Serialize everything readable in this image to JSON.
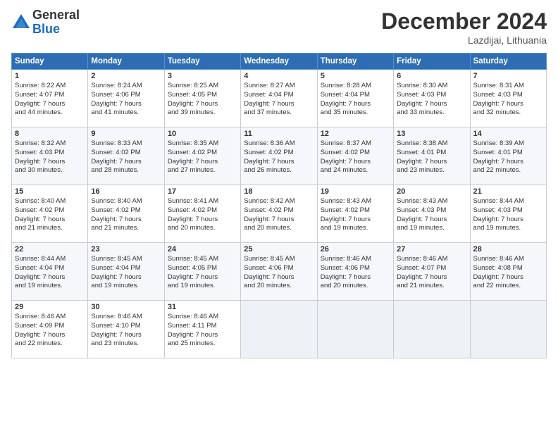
{
  "logo": {
    "general": "General",
    "blue": "Blue"
  },
  "header": {
    "month": "December 2024",
    "location": "Lazdijai, Lithuania"
  },
  "weekdays": [
    "Sunday",
    "Monday",
    "Tuesday",
    "Wednesday",
    "Thursday",
    "Friday",
    "Saturday"
  ],
  "weeks": [
    [
      {
        "day": "1",
        "lines": [
          "Sunrise: 8:22 AM",
          "Sunset: 4:07 PM",
          "Daylight: 7 hours",
          "and 44 minutes."
        ]
      },
      {
        "day": "2",
        "lines": [
          "Sunrise: 8:24 AM",
          "Sunset: 4:06 PM",
          "Daylight: 7 hours",
          "and 41 minutes."
        ]
      },
      {
        "day": "3",
        "lines": [
          "Sunrise: 8:25 AM",
          "Sunset: 4:05 PM",
          "Daylight: 7 hours",
          "and 39 minutes."
        ]
      },
      {
        "day": "4",
        "lines": [
          "Sunrise: 8:27 AM",
          "Sunset: 4:04 PM",
          "Daylight: 7 hours",
          "and 37 minutes."
        ]
      },
      {
        "day": "5",
        "lines": [
          "Sunrise: 8:28 AM",
          "Sunset: 4:04 PM",
          "Daylight: 7 hours",
          "and 35 minutes."
        ]
      },
      {
        "day": "6",
        "lines": [
          "Sunrise: 8:30 AM",
          "Sunset: 4:03 PM",
          "Daylight: 7 hours",
          "and 33 minutes."
        ]
      },
      {
        "day": "7",
        "lines": [
          "Sunrise: 8:31 AM",
          "Sunset: 4:03 PM",
          "Daylight: 7 hours",
          "and 32 minutes."
        ]
      }
    ],
    [
      {
        "day": "8",
        "lines": [
          "Sunrise: 8:32 AM",
          "Sunset: 4:03 PM",
          "Daylight: 7 hours",
          "and 30 minutes."
        ]
      },
      {
        "day": "9",
        "lines": [
          "Sunrise: 8:33 AM",
          "Sunset: 4:02 PM",
          "Daylight: 7 hours",
          "and 28 minutes."
        ]
      },
      {
        "day": "10",
        "lines": [
          "Sunrise: 8:35 AM",
          "Sunset: 4:02 PM",
          "Daylight: 7 hours",
          "and 27 minutes."
        ]
      },
      {
        "day": "11",
        "lines": [
          "Sunrise: 8:36 AM",
          "Sunset: 4:02 PM",
          "Daylight: 7 hours",
          "and 26 minutes."
        ]
      },
      {
        "day": "12",
        "lines": [
          "Sunrise: 8:37 AM",
          "Sunset: 4:02 PM",
          "Daylight: 7 hours",
          "and 24 minutes."
        ]
      },
      {
        "day": "13",
        "lines": [
          "Sunrise: 8:38 AM",
          "Sunset: 4:01 PM",
          "Daylight: 7 hours",
          "and 23 minutes."
        ]
      },
      {
        "day": "14",
        "lines": [
          "Sunrise: 8:39 AM",
          "Sunset: 4:01 PM",
          "Daylight: 7 hours",
          "and 22 minutes."
        ]
      }
    ],
    [
      {
        "day": "15",
        "lines": [
          "Sunrise: 8:40 AM",
          "Sunset: 4:02 PM",
          "Daylight: 7 hours",
          "and 21 minutes."
        ]
      },
      {
        "day": "16",
        "lines": [
          "Sunrise: 8:40 AM",
          "Sunset: 4:02 PM",
          "Daylight: 7 hours",
          "and 21 minutes."
        ]
      },
      {
        "day": "17",
        "lines": [
          "Sunrise: 8:41 AM",
          "Sunset: 4:02 PM",
          "Daylight: 7 hours",
          "and 20 minutes."
        ]
      },
      {
        "day": "18",
        "lines": [
          "Sunrise: 8:42 AM",
          "Sunset: 4:02 PM",
          "Daylight: 7 hours",
          "and 20 minutes."
        ]
      },
      {
        "day": "19",
        "lines": [
          "Sunrise: 8:43 AM",
          "Sunset: 4:02 PM",
          "Daylight: 7 hours",
          "and 19 minutes."
        ]
      },
      {
        "day": "20",
        "lines": [
          "Sunrise: 8:43 AM",
          "Sunset: 4:03 PM",
          "Daylight: 7 hours",
          "and 19 minutes."
        ]
      },
      {
        "day": "21",
        "lines": [
          "Sunrise: 8:44 AM",
          "Sunset: 4:03 PM",
          "Daylight: 7 hours",
          "and 19 minutes."
        ]
      }
    ],
    [
      {
        "day": "22",
        "lines": [
          "Sunrise: 8:44 AM",
          "Sunset: 4:04 PM",
          "Daylight: 7 hours",
          "and 19 minutes."
        ]
      },
      {
        "day": "23",
        "lines": [
          "Sunrise: 8:45 AM",
          "Sunset: 4:04 PM",
          "Daylight: 7 hours",
          "and 19 minutes."
        ]
      },
      {
        "day": "24",
        "lines": [
          "Sunrise: 8:45 AM",
          "Sunset: 4:05 PM",
          "Daylight: 7 hours",
          "and 19 minutes."
        ]
      },
      {
        "day": "25",
        "lines": [
          "Sunrise: 8:45 AM",
          "Sunset: 4:06 PM",
          "Daylight: 7 hours",
          "and 20 minutes."
        ]
      },
      {
        "day": "26",
        "lines": [
          "Sunrise: 8:46 AM",
          "Sunset: 4:06 PM",
          "Daylight: 7 hours",
          "and 20 minutes."
        ]
      },
      {
        "day": "27",
        "lines": [
          "Sunrise: 8:46 AM",
          "Sunset: 4:07 PM",
          "Daylight: 7 hours",
          "and 21 minutes."
        ]
      },
      {
        "day": "28",
        "lines": [
          "Sunrise: 8:46 AM",
          "Sunset: 4:08 PM",
          "Daylight: 7 hours",
          "and 22 minutes."
        ]
      }
    ],
    [
      {
        "day": "29",
        "lines": [
          "Sunrise: 8:46 AM",
          "Sunset: 4:09 PM",
          "Daylight: 7 hours",
          "and 22 minutes."
        ]
      },
      {
        "day": "30",
        "lines": [
          "Sunrise: 8:46 AM",
          "Sunset: 4:10 PM",
          "Daylight: 7 hours",
          "and 23 minutes."
        ]
      },
      {
        "day": "31",
        "lines": [
          "Sunrise: 8:46 AM",
          "Sunset: 4:11 PM",
          "Daylight: 7 hours",
          "and 25 minutes."
        ]
      },
      null,
      null,
      null,
      null
    ]
  ]
}
